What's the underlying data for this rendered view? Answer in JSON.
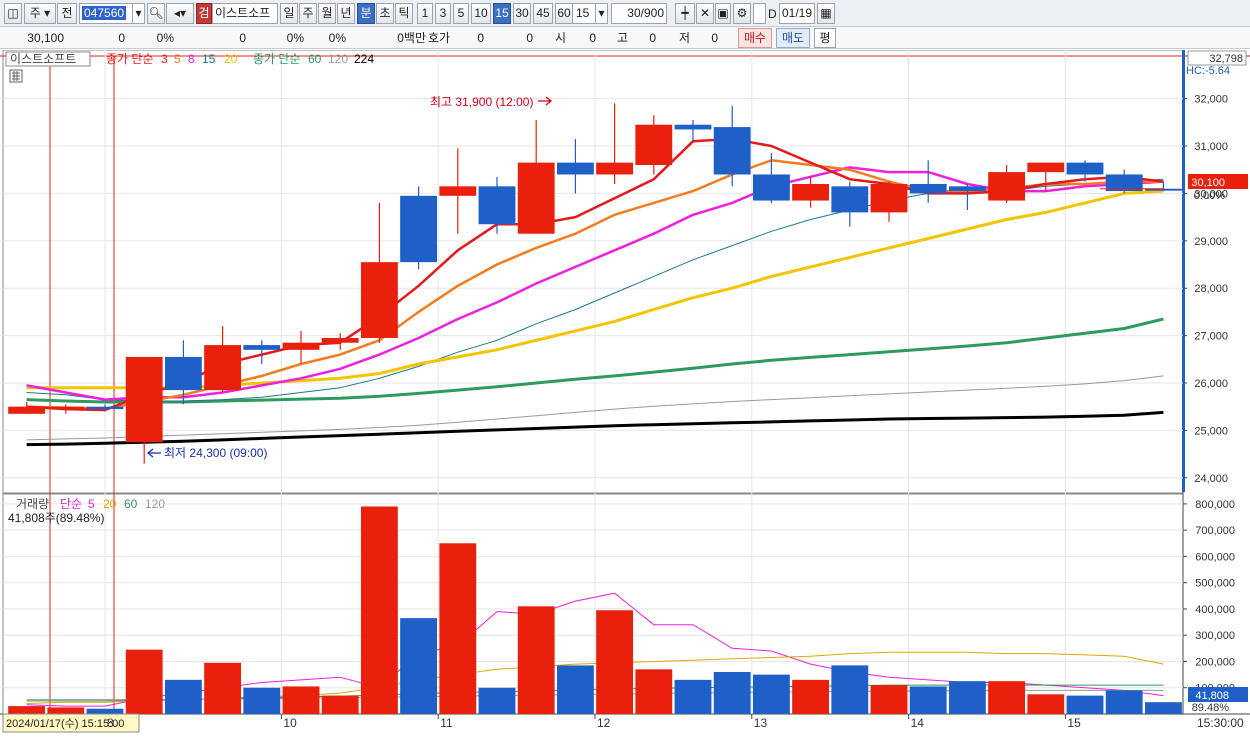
{
  "toolbar": {
    "type_select": "주",
    "prev_label": "전",
    "stock_code": "047560",
    "stock_name": "이스트소프",
    "stock_name_badge": "검",
    "period_day": "일",
    "period_week": "주",
    "period_month": "월",
    "period_year": "년",
    "period_minute": "분",
    "period_second": "초",
    "period_tick": "틱",
    "intervals": [
      "1",
      "3",
      "5",
      "10",
      "15",
      "30",
      "45",
      "60"
    ],
    "selected_interval": "15",
    "interval_dropdown": "15",
    "count_value": "30",
    "count_max": "/900",
    "checkbox_label": "D",
    "date_value": "01/19"
  },
  "quote": {
    "price": "30,100",
    "change": "0",
    "change_pct": "0%",
    "volume": "0",
    "volume_pct": "0%",
    "amount": "0백만",
    "hoga_label": "호가",
    "hoga_value": "0",
    "hoga_value2": "0",
    "open_label": "시",
    "open_value": "0",
    "high_label": "고",
    "high_value": "0",
    "low_label": "저",
    "low_value": "0",
    "buy_label": "매수",
    "sell_label": "매도",
    "avg_label": "평"
  },
  "price_legend": {
    "name": "이스트소프트",
    "ma_label": "종가 단순",
    "ma_periods": [
      "3",
      "5",
      "8",
      "15",
      "20"
    ],
    "ma2_label": "종가 단순",
    "ma2_periods": [
      "60",
      "120",
      "224"
    ]
  },
  "price_annotations": {
    "high_label": "최고 31,900 (12:00)",
    "low_label": "최저 24,300 (09:00)",
    "hc_label": "HC:-5.64",
    "axis_top_value": "32,798",
    "current_price_tag": "30,100",
    "current_pct": "0.00%"
  },
  "volume_legend": {
    "name": "거래량",
    "ma_label": "단순",
    "periods": [
      "5",
      "20",
      "60",
      "120"
    ],
    "current": "41,808주(89.48%)",
    "volume_tag": "41,808",
    "volume_pct_tag": "89.48%"
  },
  "time_axis": {
    "cursor_label": "2024/01/17(수) 15:15:00",
    "day_labels": [
      "8",
      "10",
      "11",
      "12",
      "13",
      "14",
      "15"
    ],
    "right_label": "15:30:00"
  },
  "colors": {
    "up": "#e8200c",
    "down": "#1f5fc8",
    "ma3": "#e31a1c",
    "ma5": "#f47c20",
    "ma8": "#f01fe0",
    "ma15": "#1b7a84",
    "ma20": "#f5c400",
    "ma60": "#2e9a5e",
    "ma120": "#9a9a9a",
    "ma224": "#000000"
  },
  "chart_data": {
    "type": "candlestick",
    "price_axis_ticks": [
      24000,
      25000,
      26000,
      27000,
      28000,
      29000,
      30000,
      31000,
      32000
    ],
    "volume_axis_ticks": [
      100000,
      200000,
      300000,
      400000,
      500000,
      600000,
      700000,
      800000
    ],
    "ylim": [
      23700,
      32900
    ],
    "vol_ylim": [
      0,
      830000
    ],
    "candles": [
      {
        "o": 25500,
        "h": 25600,
        "l": 25350,
        "c": 25350,
        "v": 30000,
        "up": true
      },
      {
        "o": 25450,
        "h": 25550,
        "l": 25350,
        "c": 25500,
        "v": 25000,
        "up": true
      },
      {
        "o": 25500,
        "h": 25550,
        "l": 25400,
        "c": 25450,
        "v": 20000,
        "up": false
      },
      {
        "o": 24750,
        "h": 26550,
        "l": 24300,
        "c": 26550,
        "v": 245000,
        "up": true
      },
      {
        "o": 26550,
        "h": 26900,
        "l": 25550,
        "c": 25850,
        "v": 130000,
        "up": false
      },
      {
        "o": 25850,
        "h": 27200,
        "l": 25800,
        "c": 26800,
        "v": 195000,
        "up": true
      },
      {
        "o": 26800,
        "h": 26900,
        "l": 26400,
        "c": 26700,
        "v": 100000,
        "up": false
      },
      {
        "o": 26700,
        "h": 27100,
        "l": 26400,
        "c": 26850,
        "v": 105000,
        "up": true
      },
      {
        "o": 26850,
        "h": 27050,
        "l": 26700,
        "c": 26950,
        "v": 70000,
        "up": true
      },
      {
        "o": 26950,
        "h": 29800,
        "l": 26850,
        "c": 28550,
        "v": 790000,
        "up": true
      },
      {
        "o": 29950,
        "h": 30150,
        "l": 28400,
        "c": 28550,
        "v": 365000,
        "up": false
      },
      {
        "o": 29950,
        "h": 30950,
        "l": 29150,
        "c": 30150,
        "v": 650000,
        "up": true
      },
      {
        "o": 30150,
        "h": 30350,
        "l": 29150,
        "c": 29350,
        "v": 100000,
        "up": false
      },
      {
        "o": 29150,
        "h": 31550,
        "l": 29150,
        "c": 30650,
        "v": 410000,
        "up": true
      },
      {
        "o": 30650,
        "h": 31150,
        "l": 30000,
        "c": 30400,
        "v": 185000,
        "up": false
      },
      {
        "o": 30400,
        "h": 31900,
        "l": 30200,
        "c": 30650,
        "v": 395000,
        "up": true
      },
      {
        "o": 30600,
        "h": 31650,
        "l": 30400,
        "c": 31450,
        "v": 170000,
        "up": true
      },
      {
        "o": 31450,
        "h": 31550,
        "l": 31100,
        "c": 31350,
        "v": 130000,
        "up": false
      },
      {
        "o": 31400,
        "h": 31850,
        "l": 30150,
        "c": 30400,
        "v": 160000,
        "up": false
      },
      {
        "o": 30400,
        "h": 30850,
        "l": 29800,
        "c": 29850,
        "v": 150000,
        "up": false
      },
      {
        "o": 29850,
        "h": 30350,
        "l": 29700,
        "c": 30200,
        "v": 130000,
        "up": true
      },
      {
        "o": 30150,
        "h": 30250,
        "l": 29300,
        "c": 29600,
        "v": 185000,
        "up": false
      },
      {
        "o": 29600,
        "h": 30250,
        "l": 29400,
        "c": 30200,
        "v": 110000,
        "up": true
      },
      {
        "o": 30200,
        "h": 30700,
        "l": 29800,
        "c": 30000,
        "v": 105000,
        "up": false
      },
      {
        "o": 30050,
        "h": 30200,
        "l": 29650,
        "c": 30150,
        "v": 125000,
        "up": false
      },
      {
        "o": 29850,
        "h": 30600,
        "l": 29800,
        "c": 30450,
        "v": 125000,
        "up": true
      },
      {
        "o": 30450,
        "h": 30650,
        "l": 30050,
        "c": 30650,
        "v": 75000,
        "up": true
      },
      {
        "o": 30650,
        "h": 30700,
        "l": 30250,
        "c": 30400,
        "v": 70000,
        "up": false
      },
      {
        "o": 30400,
        "h": 30500,
        "l": 30000,
        "c": 30050,
        "v": 90000,
        "up": false
      },
      {
        "o": 30100,
        "h": 30250,
        "l": 30050,
        "c": 30100,
        "v": 45000,
        "up": false
      }
    ],
    "ma_series": [
      {
        "period": "3",
        "values": [
          25500,
          25450,
          25430,
          25750,
          26000,
          26400,
          26600,
          26800,
          26850,
          27400,
          28050,
          28800,
          29350,
          29350,
          29500,
          29900,
          30300,
          31100,
          31150,
          31000,
          30650,
          30300,
          30200,
          30000,
          30000,
          30050,
          30200,
          30300,
          30350,
          30250
        ]
      },
      {
        "period": "5",
        "values": [
          25500,
          25480,
          25460,
          25600,
          25750,
          25950,
          26150,
          26400,
          26600,
          26900,
          27500,
          28050,
          28500,
          28850,
          29150,
          29550,
          29800,
          30050,
          30400,
          30700,
          30600,
          30500,
          30250,
          30050,
          30050,
          30100,
          30200,
          30200,
          30250,
          30250
        ]
      },
      {
        "period": "8",
        "values": [
          25950,
          25800,
          25650,
          25700,
          25700,
          25800,
          25950,
          26100,
          26300,
          26600,
          26950,
          27350,
          27700,
          28100,
          28450,
          28800,
          29150,
          29550,
          29800,
          30150,
          30350,
          30550,
          30450,
          30450,
          30200,
          30050,
          30050,
          30150,
          30200,
          30250
        ]
      },
      {
        "period": "15",
        "values": [
          25800,
          25750,
          25650,
          25620,
          25620,
          25650,
          25700,
          25800,
          25900,
          26100,
          26350,
          26650,
          26900,
          27250,
          27550,
          27900,
          28250,
          28600,
          28900,
          29200,
          29450,
          29650,
          29850,
          30000,
          30050,
          30050,
          30150,
          30200,
          30250,
          30300
        ]
      },
      {
        "period": "20",
        "values": [
          25900,
          25900,
          25900,
          25900,
          25900,
          25950,
          26000,
          26050,
          26100,
          26200,
          26400,
          26550,
          26700,
          26900,
          27100,
          27300,
          27550,
          27800,
          28000,
          28250,
          28450,
          28650,
          28850,
          29050,
          29250,
          29450,
          29600,
          29800,
          30000,
          30050
        ]
      },
      {
        "period": "60",
        "values": [
          25650,
          25620,
          25600,
          25600,
          25600,
          25620,
          25640,
          25660,
          25680,
          25720,
          25780,
          25850,
          25920,
          26000,
          26080,
          26150,
          26230,
          26310,
          26400,
          26480,
          26540,
          26600,
          26660,
          26720,
          26780,
          26850,
          26950,
          27050,
          27150,
          27350
        ]
      },
      {
        "period": "120",
        "values": [
          24800,
          24820,
          24840,
          24870,
          24900,
          24930,
          24960,
          24990,
          25020,
          25060,
          25110,
          25170,
          25240,
          25310,
          25380,
          25450,
          25510,
          25560,
          25610,
          25650,
          25690,
          25730,
          25770,
          25810,
          25850,
          25890,
          25930,
          25980,
          26050,
          26150
        ]
      },
      {
        "period": "224",
        "values": [
          24700,
          24710,
          24730,
          24750,
          24770,
          24800,
          24830,
          24860,
          24890,
          24920,
          24950,
          24980,
          25010,
          25040,
          25070,
          25100,
          25120,
          25140,
          25160,
          25180,
          25200,
          25220,
          25240,
          25250,
          25260,
          25270,
          25280,
          25300,
          25320,
          25380
        ]
      }
    ],
    "vol_ma_series": [
      {
        "period": "5",
        "values": [
          35000,
          30000,
          30000,
          60000,
          80000,
          100000,
          120000,
          130000,
          140000,
          100000,
          230000,
          260000,
          390000,
          380000,
          430000,
          460000,
          340000,
          340000,
          250000,
          240000,
          190000,
          160000,
          140000,
          130000,
          120000,
          120000,
          110000,
          100000,
          90000,
          70000
        ]
      },
      {
        "period": "20",
        "values": [
          40000,
          45000,
          45000,
          50000,
          55000,
          60000,
          65000,
          70000,
          80000,
          100000,
          130000,
          150000,
          170000,
          180000,
          190000,
          195000,
          200000,
          205000,
          210000,
          215000,
          220000,
          230000,
          235000,
          235000,
          235000,
          230000,
          230000,
          225000,
          220000,
          190000
        ]
      },
      {
        "period": "60",
        "values": [
          50000,
          50000,
          50000,
          52000,
          55000,
          58000,
          62000,
          65000,
          68000,
          72000,
          78000,
          82000,
          85000,
          88000,
          92000,
          95000,
          98000,
          100000,
          102000,
          104000,
          106000,
          108000,
          110000,
          110000,
          110000,
          110000,
          110000,
          110000,
          110000,
          110000
        ]
      },
      {
        "period": "120",
        "values": [
          55000,
          55000,
          55000,
          55000,
          56000,
          57000,
          58000,
          60000,
          62000,
          64000,
          66000,
          68000,
          70000,
          72000,
          74000,
          76000,
          78000,
          80000,
          82000,
          84000,
          85000,
          86000,
          87000,
          88000,
          89000,
          90000,
          90000,
          90000,
          90000,
          90000
        ]
      }
    ]
  }
}
